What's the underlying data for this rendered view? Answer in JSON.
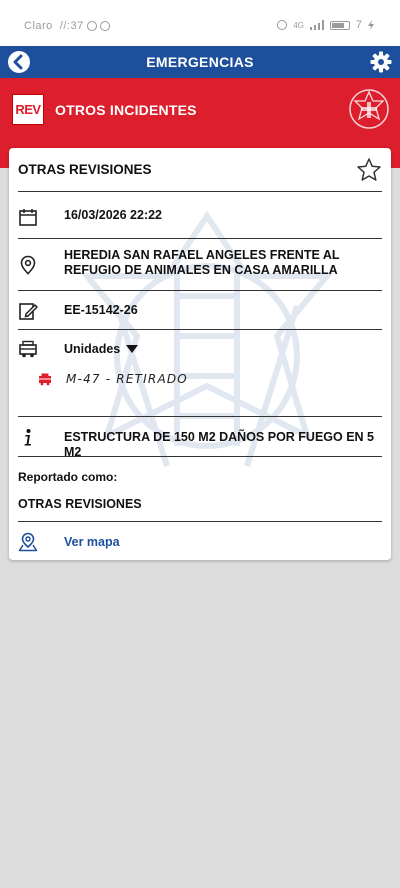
{
  "status_bar": {
    "carrier": "Claro",
    "time": "//:37",
    "battery": "7",
    "network": "4G"
  },
  "app_bar": {
    "title": "EMERGENCIAS",
    "back_icon": "back-arrow-icon",
    "settings_icon": "gear-icon"
  },
  "incident": {
    "badge": "REV",
    "type": "OTROS INCIDENTES",
    "emblem_icon": "firefighter-emblem-icon"
  },
  "card": {
    "title": "OTRAS REVISIONES",
    "date_time": "16/03/2026 22:22",
    "address": "HEREDIA SAN RAFAEL ANGELES FRENTE AL REFUGIO DE ANIMALES EN CASA AMARILLA",
    "code": "EE-15142-26",
    "units_label": "Unidades",
    "units": [
      {
        "text": "M-47 - RETIRADO",
        "icon": "fire-truck-icon"
      }
    ],
    "description": "ESTRUCTURA DE 150 M2 DAÑOS POR FUEGO EN 5 M2",
    "reported_label": "Reportado como:",
    "reported_value": "OTRAS REVISIONES",
    "map_link": "Ver mapa"
  },
  "colors": {
    "primary_blue": "#1d4f9c",
    "alert_red": "#dc1e2d",
    "background": "#dcdcdc"
  }
}
